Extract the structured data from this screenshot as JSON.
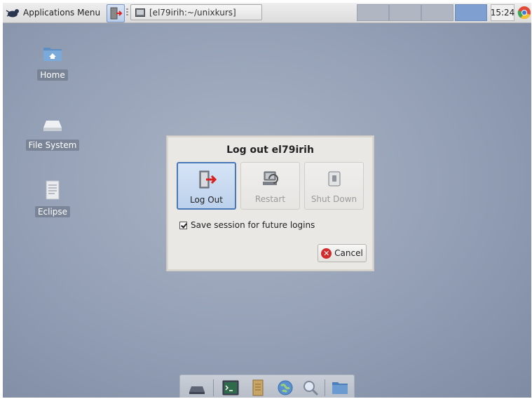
{
  "panel": {
    "app_menu_label": "Applications Menu",
    "task_title": "[el79irih:~/unixkurs]",
    "clock": "15:24",
    "workspaces": 4,
    "active_workspace": 4
  },
  "desktop": {
    "icons": [
      {
        "label": "Home",
        "icon": "home-folder-icon"
      },
      {
        "label": "File System",
        "icon": "drive-icon"
      },
      {
        "label": "Eclipse",
        "icon": "document-icon"
      }
    ]
  },
  "dialog": {
    "title": "Log out el79irih",
    "logout_label": "Log Out",
    "restart_label": "Restart",
    "shutdown_label": "Shut Down",
    "save_session_label": "Save session for future logins",
    "save_session_checked": true,
    "cancel_label": "Cancel"
  },
  "dock": {
    "items": [
      "desktop-icon",
      "terminal-icon",
      "file-manager-icon",
      "browser-icon",
      "search-icon",
      "folder-icon"
    ]
  },
  "colors": {
    "desktop_bg": "#939fb5",
    "selected_accent": "#4a78b5",
    "cancel_red": "#d22b2b"
  }
}
